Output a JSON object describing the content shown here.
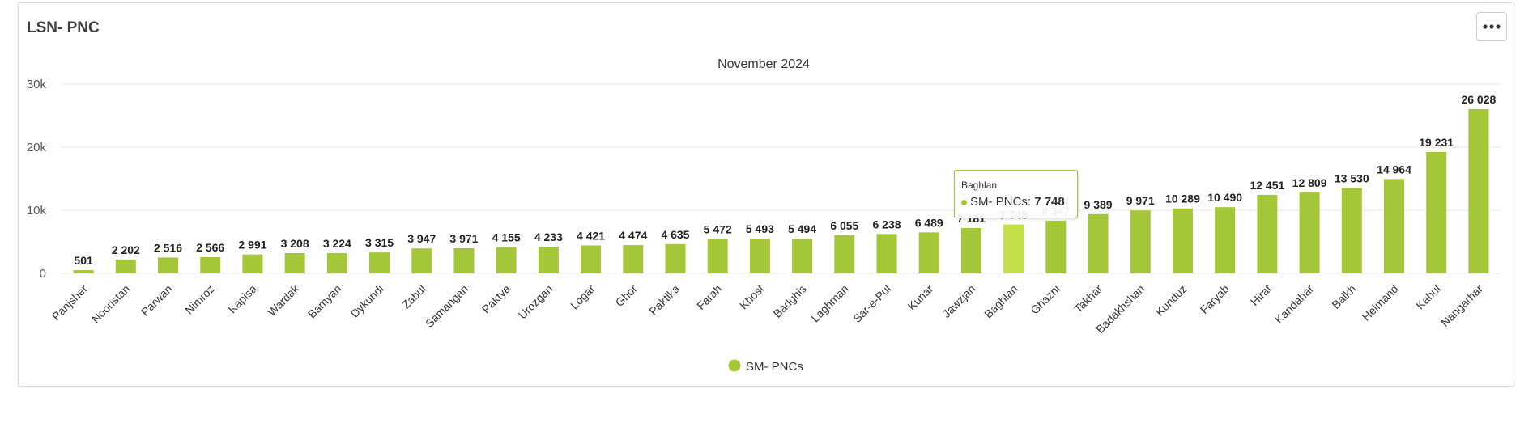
{
  "card": {
    "title": "LSN- PNC",
    "menu_icon": "more-horizontal-icon"
  },
  "tooltip": {
    "category": "Baghlan",
    "series": "SM- PNCs",
    "value": "7 748"
  },
  "colors": {
    "bar": "#a4c639",
    "bar_hover": "#c2df4a",
    "grid": "#e6e6e6"
  },
  "chart_data": {
    "type": "bar",
    "title": "November 2024",
    "xlabel": "",
    "ylabel": "",
    "ylim": [
      0,
      30000
    ],
    "yticks": [
      0,
      10000,
      20000,
      30000
    ],
    "ytick_labels": [
      "0",
      "10k",
      "20k",
      "30k"
    ],
    "grid": true,
    "legend_position": "bottom-center",
    "categories": [
      "Panjsher",
      "Nooristan",
      "Parwan",
      "Nimroz",
      "Kapisa",
      "Wardak",
      "Bamyan",
      "Dykundi",
      "Zabul",
      "Samangan",
      "Paktya",
      "Urozgan",
      "Logar",
      "Ghor",
      "Paktika",
      "Farah",
      "Khost",
      "Badghis",
      "Laghman",
      "Sar-e-Pul",
      "Kunar",
      "Jawzjan",
      "Baghlan",
      "Ghazni",
      "Takhar",
      "Badakhshan",
      "Kunduz",
      "Faryab",
      "Hirat",
      "Kandahar",
      "Balkh",
      "Helmand",
      "Kabul",
      "Nangarhar"
    ],
    "series": [
      {
        "name": "SM- PNCs",
        "values": [
          501,
          2202,
          2516,
          2566,
          2991,
          3208,
          3224,
          3315,
          3947,
          3971,
          4155,
          4233,
          4421,
          4474,
          4635,
          5472,
          5493,
          5494,
          6055,
          6238,
          6489,
          7181,
          7748,
          8347,
          9389,
          9971,
          10289,
          10490,
          12451,
          12809,
          13530,
          14964,
          19231,
          26028
        ],
        "labels": [
          "501",
          "2 202",
          "2 516",
          "2 566",
          "2 991",
          "3 208",
          "3 224",
          "3 315",
          "3 947",
          "3 971",
          "4 155",
          "4 233",
          "4 421",
          "4 474",
          "4 635",
          "5 472",
          "5 493",
          "5 494",
          "6 055",
          "6 238",
          "6 489",
          "7 181",
          "7 748",
          "8 347",
          "9 389",
          "9 971",
          "10 289",
          "10 490",
          "12 451",
          "12 809",
          "13 530",
          "14 964",
          "19 231",
          "26 028"
        ]
      }
    ],
    "highlighted_category": "Baghlan"
  }
}
